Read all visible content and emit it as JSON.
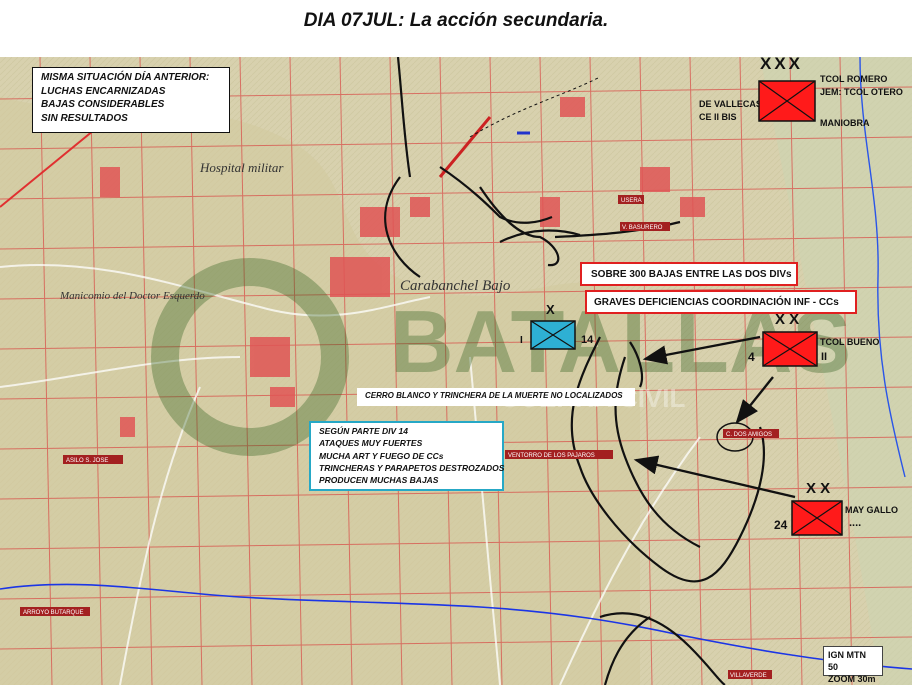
{
  "title": "DIA 07JUL: La acción secundaria.",
  "situation_box": [
    "MISMA SITUACIÓN DÍA ANTERIOR:",
    "LUCHAS ENCARNIZADAS",
    "BAJAS CONSIDERABLES",
    "SIN RESULTADOS"
  ],
  "callouts": {
    "casualties": "SOBRE 300 BAJAS ENTRE  LAS DOS DIVs",
    "coordination": "GRAVES DEFICIENCIAS COORDINACIÓN  INF - CCs",
    "cerro_blanco": "CERRO BLANCO Y TRINCHERA DE LA MUERTE NO LOCALIZADOS"
  },
  "div14_report": [
    "SEGÚN PARTE DIV 14",
    "ATAQUES MUY FUERTES",
    "MUCHA ART Y FUEGO DE CCs",
    "TRINCHERAS Y PARAPETOS DESTROZADOS",
    "PRODUCEN MUCHAS BAJAS"
  ],
  "units": {
    "corps": {
      "echelon": "XXX",
      "left_lines": [
        "DE VALLECAS",
        "CE II BIS"
      ],
      "right_lines": [
        "TCOL ROMERO",
        "JEM: TCOL OTERO"
      ],
      "bottom": "MANIOBRA",
      "color": "#ff1a1a"
    },
    "bueno": {
      "echelon": "X X",
      "number": "4",
      "roman": "II",
      "commander": "TCOL BUENO",
      "color": "#ff1a1a"
    },
    "gallo": {
      "echelon": "X X",
      "number": "24",
      "dots": "....",
      "commander": "MAY GALLO",
      "color": "#ff1a1a"
    },
    "nationalist": {
      "echelon": "X",
      "left": "I",
      "number": "14",
      "color": "#2eb0d4"
    }
  },
  "map_labels": {
    "arroyo": "ARROYO BUTARQUE",
    "asilo": "ASILO S. JOSE",
    "ventorro": "VENTORRO DE LOS PAJAROS",
    "dos_amigos": "C. DOS AMIGOS",
    "usera": "USERA",
    "basurero": "V. BASURERO",
    "villaverde": "VILLAVERDE",
    "carabanchel": "Carabanchel Bajo",
    "hospital": "Hospital militar",
    "manicomio": "Manicomio del Doctor Esquerdo",
    "watermark": "BATALLAS",
    "watermark_sub": "GUERRA CIVIL"
  },
  "scale": [
    "IGN MTN 50",
    "ZOOM 30m"
  ]
}
